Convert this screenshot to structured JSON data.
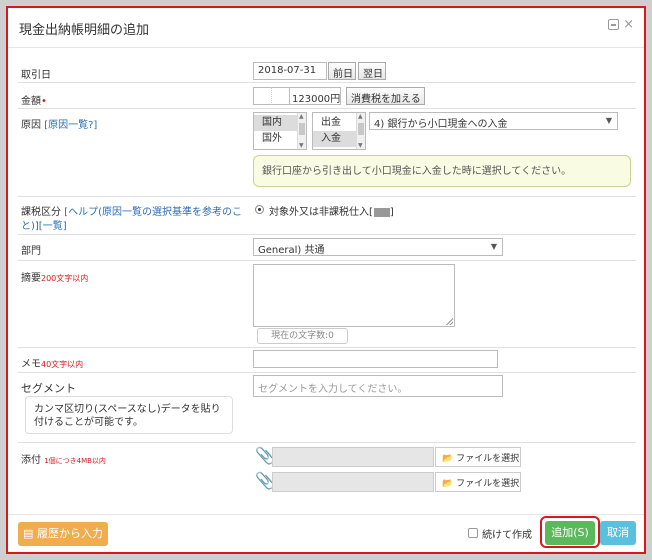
{
  "dialog": {
    "title": "現金出納帳明細の追加"
  },
  "fields": {
    "date": {
      "label": "取引日",
      "value": "2018-07-31",
      "prev_label": "前日",
      "next_label": "翌日"
    },
    "amount": {
      "label": "金額",
      "required_mark": "•",
      "value": "123000",
      "unit": "円",
      "tax_button": "消費税を加える"
    },
    "reason": {
      "label": "原因",
      "link_label": "[原因一覧?]",
      "domestic_options": [
        "国内",
        "国外"
      ],
      "direction_options": [
        "出金",
        "入金"
      ],
      "selected_reason": "4) 銀行から小口現金への入金",
      "hint": "銀行口座から引き出して小口現金に入金した時に選択してください。"
    },
    "tax": {
      "label": "課税区分",
      "link_label": "[ヘルプ(原因一覧の選択基準を参考のこと)][一覧]",
      "option": "対象外又は非課税仕入"
    },
    "department": {
      "label": "部門",
      "value": "General) 共通"
    },
    "summary": {
      "label": "摘要",
      "limit": "200文字以内",
      "counter": "現在の文字数:0"
    },
    "memo": {
      "label": "メモ",
      "limit": "40文字以内"
    },
    "segment": {
      "label": "セグメント",
      "placeholder": "セグメントを入力してください。",
      "note": "カンマ区切り(スペースなし)データを貼り付けることが可能です。"
    },
    "attachment": {
      "label": "添付",
      "limit": "1個につき4MB以内",
      "file_button": "ファイルを選択"
    }
  },
  "footer": {
    "history_button": "履歴から入力",
    "continue_label": "続けて作成",
    "add_button": "追加(S)",
    "cancel_button": "取消"
  },
  "icons": {
    "close": "close-icon",
    "minimize": "minimize-icon",
    "clip": "paperclip-icon",
    "folder": "folder-open-icon",
    "history": "database-icon"
  },
  "colors": {
    "accent_red": "#d7191c",
    "history_orange": "#f0ad4e",
    "add_green": "#5cb85c",
    "cancel_blue": "#5bc0de",
    "link_blue": "#2a6db5"
  }
}
